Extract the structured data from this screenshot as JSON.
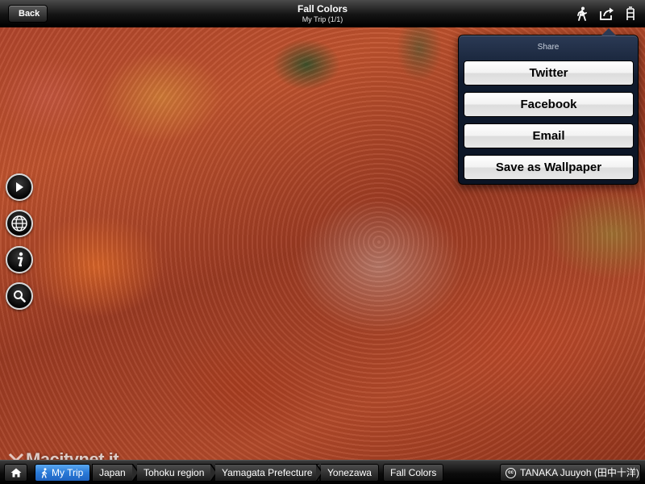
{
  "topbar": {
    "back_label": "Back",
    "title": "Fall Colors",
    "subtitle": "My Trip (1/1)",
    "icons": [
      "walking-person-icon",
      "share-icon",
      "bookmark-icon"
    ]
  },
  "share": {
    "header": "Share",
    "options": [
      "Twitter",
      "Facebook",
      "Email",
      "Save as Wallpaper"
    ]
  },
  "side_buttons": [
    "play-icon",
    "globe-icon",
    "info-icon",
    "search-icon"
  ],
  "watermark": "Macitynet.it",
  "breadcrumb": {
    "items": [
      "My Trip",
      "Japan",
      "Tohoku region",
      "Yamagata Prefecture",
      "Yonezawa"
    ],
    "current": "Fall Colors"
  },
  "credit": {
    "cc": "cc",
    "author": "TANAKA Juuyoh (田中十洋)"
  },
  "colors": {
    "accent": "#2a7ad8",
    "bar": "#141414",
    "popover": "#0f1a2d"
  }
}
